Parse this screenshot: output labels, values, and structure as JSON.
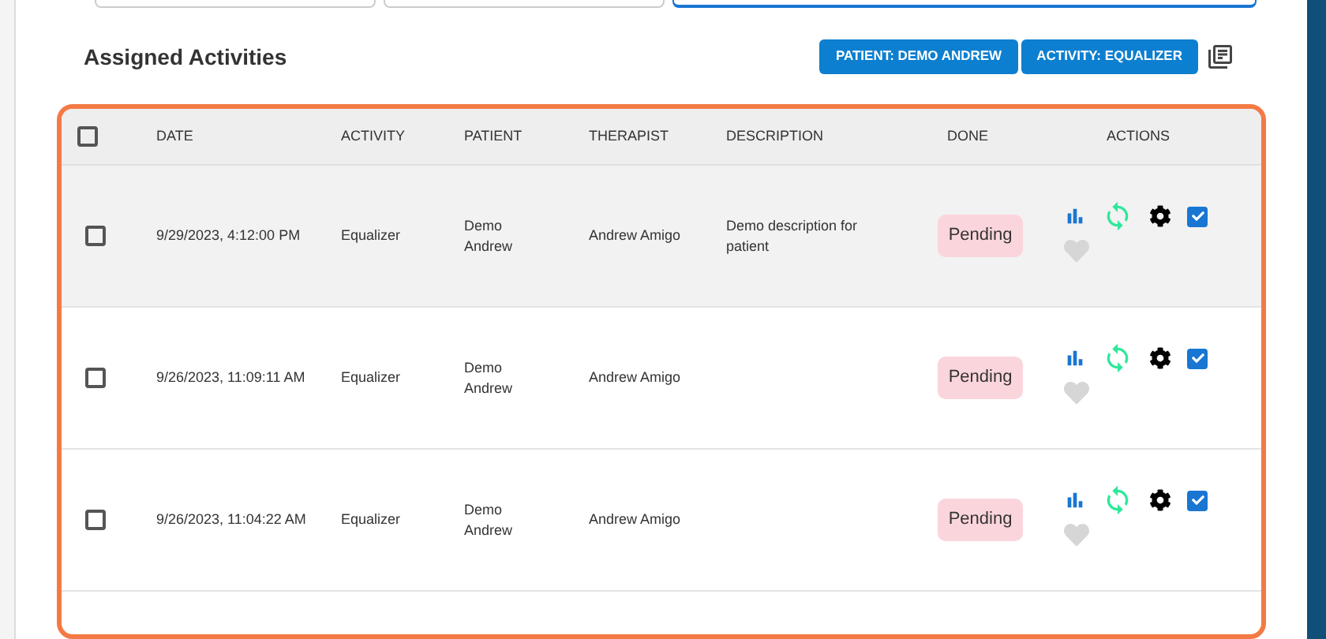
{
  "filter_fields": [
    {
      "focused": false
    },
    {
      "focused": false
    },
    {
      "focused": true
    }
  ],
  "section_title": "Assigned Activities",
  "filter_chips": [
    "PATIENT: DEMO ANDREW",
    "ACTIVITY: EQUALIZER"
  ],
  "table": {
    "all_selected": false,
    "columns": [
      "DATE",
      "ACTIVITY",
      "PATIENT",
      "THERAPIST",
      "DESCRIPTION",
      "DONE",
      "ACTIONS"
    ],
    "rows": [
      {
        "selected": false,
        "highlighted": true,
        "date": "9/29/2023, 4:12:00 PM",
        "activity": "Equalizer",
        "patient": "Demo Andrew",
        "therapist": "Andrew Amigo",
        "description": "Demo description for patient",
        "status": "Pending",
        "done_checked": true,
        "favorite": false
      },
      {
        "selected": false,
        "highlighted": false,
        "date": "9/26/2023, 11:09:11 AM",
        "activity": "Equalizer",
        "patient": "Demo Andrew",
        "therapist": "Andrew Amigo",
        "status": "Pending",
        "done_checked": true,
        "favorite": false
      },
      {
        "selected": false,
        "highlighted": false,
        "date": "9/26/2023, 11:04:22 AM",
        "activity": "Equalizer",
        "patient": "Demo Andrew",
        "therapist": "Andrew Amigo",
        "status": "Pending",
        "done_checked": true,
        "favorite": false
      }
    ]
  }
}
